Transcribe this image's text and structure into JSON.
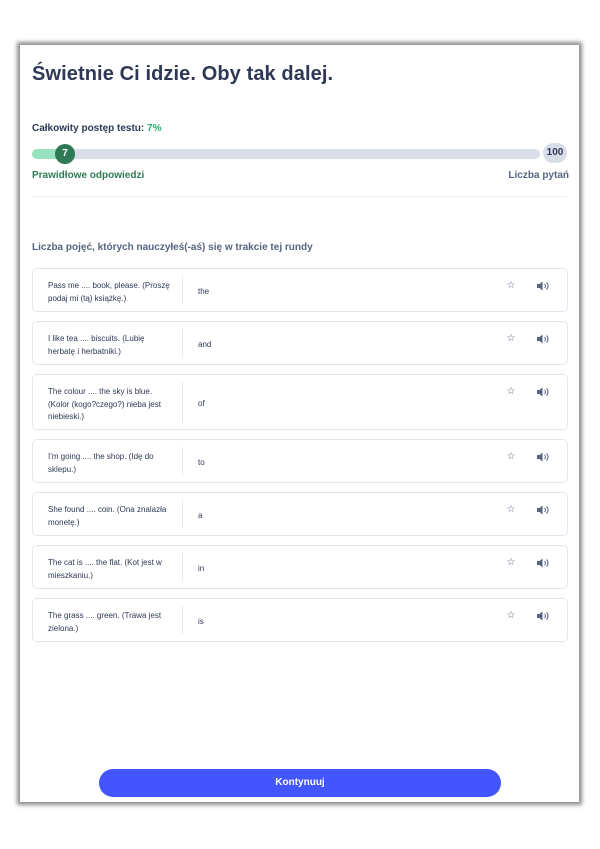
{
  "header": {
    "title": "Świetnie Ci idzie. Oby tak dalej."
  },
  "progress": {
    "label": "Całkowity postęp testu:",
    "percent_text": "7%",
    "correct_count": "7",
    "total_count": "100",
    "fraction": 0.07,
    "legend_correct": "Prawidłowe odpowiedzi",
    "legend_total": "Liczba pytań"
  },
  "section": {
    "title": "Liczba pojęć, których nauczyłeś(-aś) się w trakcie tej rundy"
  },
  "terms": [
    {
      "term": "Pass me .... book, please. (Proszę podaj mi (tą) książkę.)",
      "definition": "the"
    },
    {
      "term": "I like tea .... biscuits. (Lubię herbatę i herbatniki.)",
      "definition": "and"
    },
    {
      "term": "The colour .... the sky is blue. (Kolor (kogo?czego?) nieba jest niebieski.)",
      "definition": "of"
    },
    {
      "term": "I'm going .... the shop. (Idę do sklepu.)",
      "definition": "to"
    },
    {
      "term": "She found .... coin. (Ona znalazła monetę.)",
      "definition": "a"
    },
    {
      "term": "The cat is .... the flat. (Kot jest w mieszkaniu.)",
      "definition": "in"
    },
    {
      "term": "The grass .... green. (Trawa jest zielona.)",
      "definition": "is"
    }
  ],
  "icons": {
    "star": "star-icon",
    "audio": "speaker-icon"
  },
  "footer": {
    "continue_label": "Kontynuuj"
  },
  "colors": {
    "primary": "#4255ff",
    "success": "#23b26d",
    "success_dark": "#2e7a57",
    "text": "#2e3856",
    "muted": "#586380"
  }
}
